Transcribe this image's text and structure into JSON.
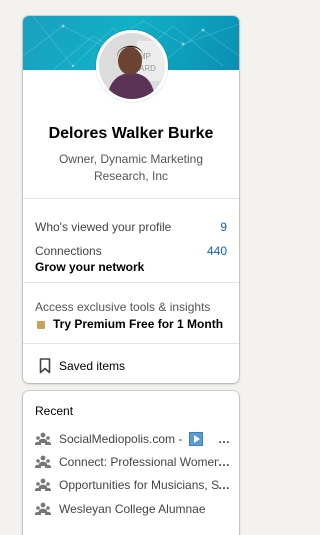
{
  "profile": {
    "name": "Delores Walker Burke",
    "headline": "Owner, Dynamic Marketing Research, Inc"
  },
  "stats": {
    "viewers_label": "Who's viewed your profile",
    "viewers_count": "9",
    "connections_label": "Connections",
    "connections_count": "440",
    "grow_label": "Grow your network"
  },
  "premium": {
    "description": "Access exclusive tools & insights",
    "cta": "Try Premium Free for 1 Month"
  },
  "saved": {
    "label": "Saved items",
    "icon": "bookmark-icon"
  },
  "recent": {
    "title": "Recent",
    "items": [
      {
        "label": "SocialMediopolis.com - ",
        "icon": "group-icon"
      },
      {
        "label": "Connect: Professional Women's Network",
        "icon": "group-icon"
      },
      {
        "label": "Opportunities for Musicians, Singers",
        "icon": "group-icon"
      },
      {
        "label": "Wesleyan College Alumnae",
        "icon": "group-icon"
      }
    ]
  },
  "colors": {
    "accent_link": "#0a66c2",
    "banner": "#10b0c6",
    "premium_gold": "#c9a25a"
  }
}
